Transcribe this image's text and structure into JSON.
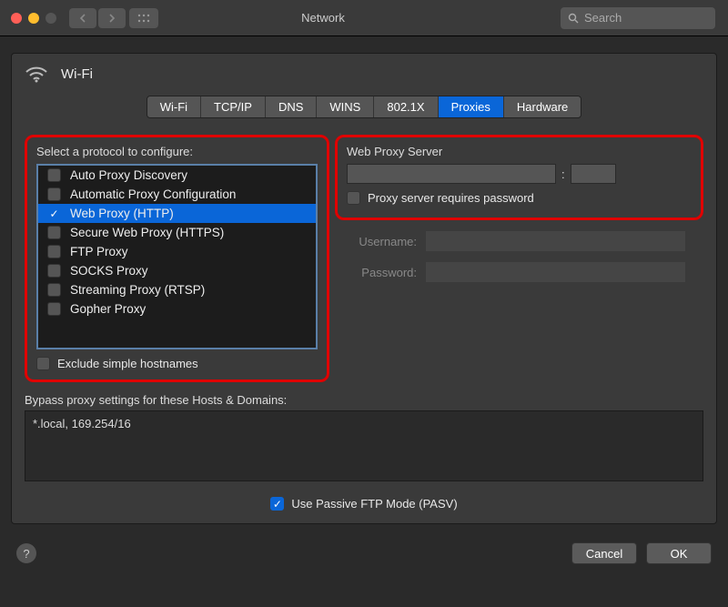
{
  "window": {
    "title": "Network",
    "search_placeholder": "Search"
  },
  "header": {
    "interface": "Wi-Fi"
  },
  "tabs": [
    {
      "label": "Wi-Fi",
      "active": false
    },
    {
      "label": "TCP/IP",
      "active": false
    },
    {
      "label": "DNS",
      "active": false
    },
    {
      "label": "WINS",
      "active": false
    },
    {
      "label": "802.1X",
      "active": false
    },
    {
      "label": "Proxies",
      "active": true
    },
    {
      "label": "Hardware",
      "active": false
    }
  ],
  "left": {
    "label": "Select a protocol to configure:",
    "protocols": [
      {
        "label": "Auto Proxy Discovery",
        "checked": false,
        "selected": false
      },
      {
        "label": "Automatic Proxy Configuration",
        "checked": false,
        "selected": false
      },
      {
        "label": "Web Proxy (HTTP)",
        "checked": true,
        "selected": true
      },
      {
        "label": "Secure Web Proxy (HTTPS)",
        "checked": false,
        "selected": false
      },
      {
        "label": "FTP Proxy",
        "checked": false,
        "selected": false
      },
      {
        "label": "SOCKS Proxy",
        "checked": false,
        "selected": false
      },
      {
        "label": "Streaming Proxy (RTSP)",
        "checked": false,
        "selected": false
      },
      {
        "label": "Gopher Proxy",
        "checked": false,
        "selected": false
      }
    ],
    "exclude_label": "Exclude simple hostnames",
    "exclude_checked": false
  },
  "right": {
    "title": "Web Proxy Server",
    "host": "",
    "port": "",
    "auth_label": "Proxy server requires password",
    "auth_checked": false,
    "username_label": "Username:",
    "username": "",
    "password_label": "Password:",
    "password": ""
  },
  "bypass": {
    "label": "Bypass proxy settings for these Hosts & Domains:",
    "value": "*.local, 169.254/16"
  },
  "pasv": {
    "label": "Use Passive FTP Mode (PASV)",
    "checked": true
  },
  "footer": {
    "cancel": "Cancel",
    "ok": "OK"
  }
}
